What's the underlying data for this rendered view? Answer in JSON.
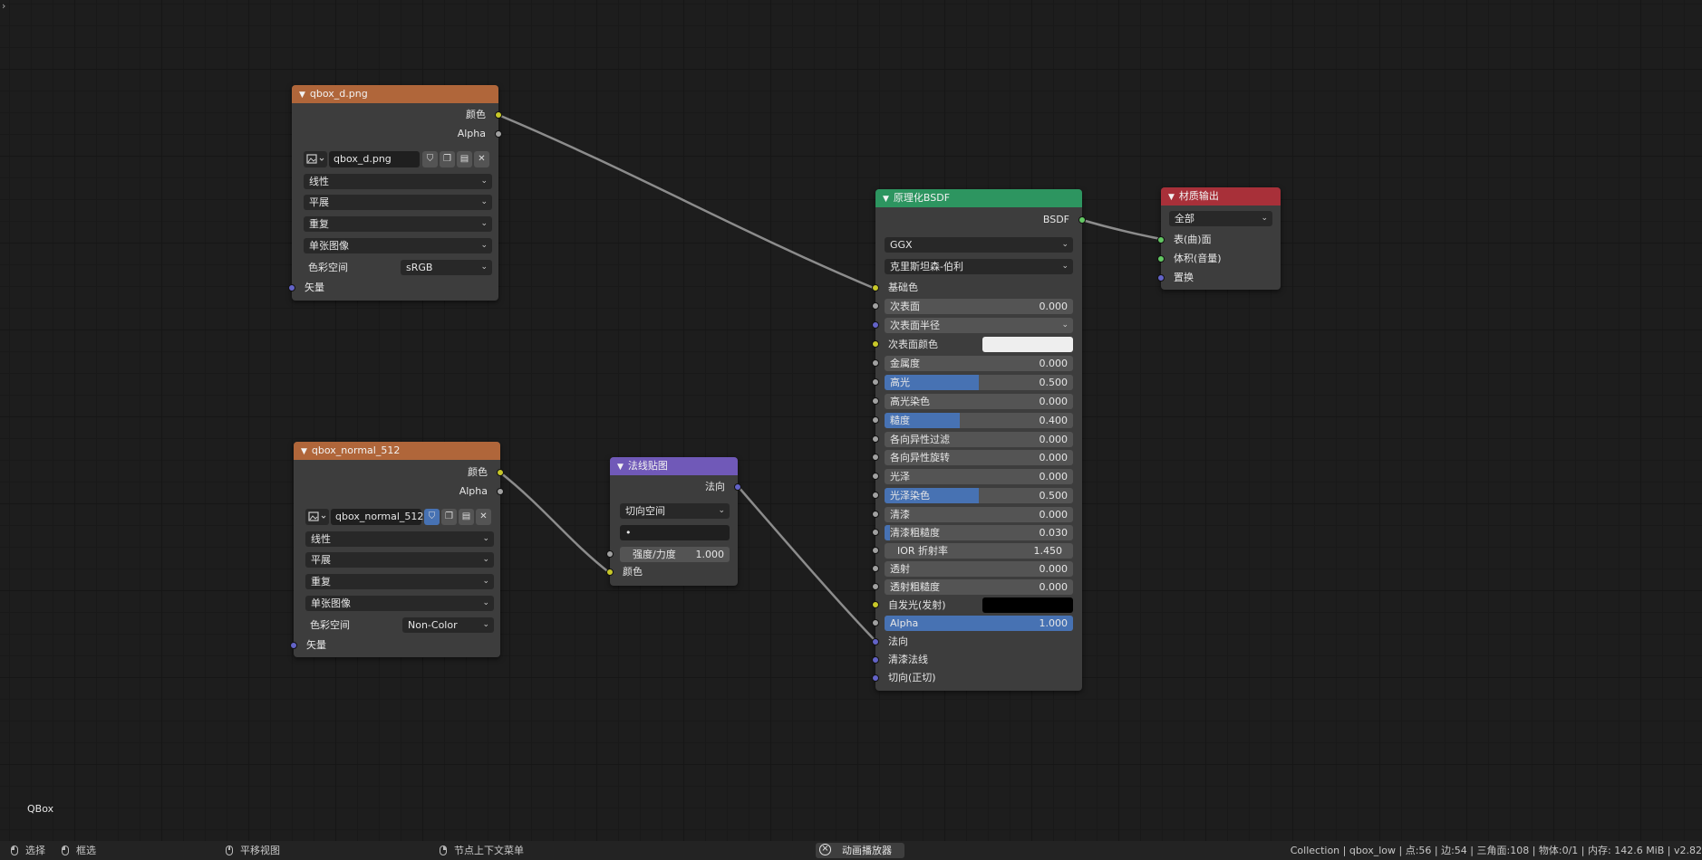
{
  "scene_label": "QBox",
  "node_diffuse": {
    "title": "qbox_d.png",
    "out_color": "颜色",
    "out_alpha": "Alpha",
    "image_name": "qbox_d.png",
    "interpolation": "线性",
    "projection": "平展",
    "extension": "重复",
    "source": "单张图像",
    "colorspace_label": "色彩空间",
    "colorspace_value": "sRGB",
    "in_vector": "矢量"
  },
  "node_normal_img": {
    "title": "qbox_normal_512",
    "out_color": "颜色",
    "out_alpha": "Alpha",
    "image_name": "qbox_normal_512",
    "interpolation": "线性",
    "projection": "平展",
    "extension": "重复",
    "source": "单张图像",
    "colorspace_label": "色彩空间",
    "colorspace_value": "Non-Color",
    "in_vector": "矢量"
  },
  "node_normal_map": {
    "title": "法线贴图",
    "out_normal": "法向",
    "space": "切向空间",
    "uv_value": "•",
    "strength_label": "强度/力度",
    "strength_value": "1.000",
    "in_color": "颜色"
  },
  "node_bsdf": {
    "title": "原理化BSDF",
    "out_bsdf": "BSDF",
    "distribution": "GGX",
    "subsurface_method": "克里斯坦森-伯利",
    "base_color": "基础色",
    "subsurface_radius": "次表面半径",
    "subsurface_color": "次表面颜色",
    "emission": "自发光(发射)",
    "normal": "法向",
    "clearcoat_normal": "清漆法线",
    "tangent": "切向(正切)",
    "fields": {
      "subsurface": {
        "label": "次表面",
        "value": "0.000",
        "fill": 0.0
      },
      "metallic": {
        "label": "金属度",
        "value": "0.000",
        "fill": 0.0
      },
      "specular": {
        "label": "高光",
        "value": "0.500",
        "fill": 0.5
      },
      "specular_tint": {
        "label": "高光染色",
        "value": "0.000",
        "fill": 0.0
      },
      "roughness": {
        "label": "糙度",
        "value": "0.400",
        "fill": 0.4
      },
      "anisotropic": {
        "label": "各向异性过滤",
        "value": "0.000",
        "fill": 0.0
      },
      "anisotropic_rotation": {
        "label": "各向异性旋转",
        "value": "0.000",
        "fill": 0.0
      },
      "sheen": {
        "label": "光泽",
        "value": "0.000",
        "fill": 0.0
      },
      "sheen_tint": {
        "label": "光泽染色",
        "value": "0.500",
        "fill": 0.5
      },
      "clearcoat": {
        "label": "清漆",
        "value": "0.000",
        "fill": 0.0
      },
      "clearcoat_roughness": {
        "label": "清漆粗糙度",
        "value": "0.030",
        "fill": 0.03
      },
      "ior": {
        "label": "IOR 折射率",
        "value": "1.450"
      },
      "transmission": {
        "label": "透射",
        "value": "0.000",
        "fill": 0.0
      },
      "transmission_roughness": {
        "label": "透射粗糙度",
        "value": "0.000",
        "fill": 0.0
      },
      "alpha": {
        "label": "Alpha",
        "value": "1.000",
        "fill": 1.0
      }
    },
    "subsurface_color_hex": "#eeeeee",
    "emission_color_hex": "#000000"
  },
  "node_output": {
    "title": "材质输出",
    "target": "全部",
    "in_surface": "表(曲)面",
    "in_volume": "体积(音量)",
    "in_displacement": "置换"
  },
  "statusbar": {
    "select": "选择",
    "box_select": "框选",
    "pan_view": "平移视图",
    "context_menu": "节点上下文菜单",
    "playback": "动画播放器",
    "info": "Collection | qbox_low | 点:56 | 边:54 | 三角面:108 | 物体:0/1  | 内存: 142.6 MiB | v2.82"
  },
  "colors": {
    "image_header": "#b0663a",
    "vector_header": "#7059b8",
    "shader_header": "#2d9560",
    "output_header": "#a83039",
    "slider_fill": "#4772b3"
  }
}
